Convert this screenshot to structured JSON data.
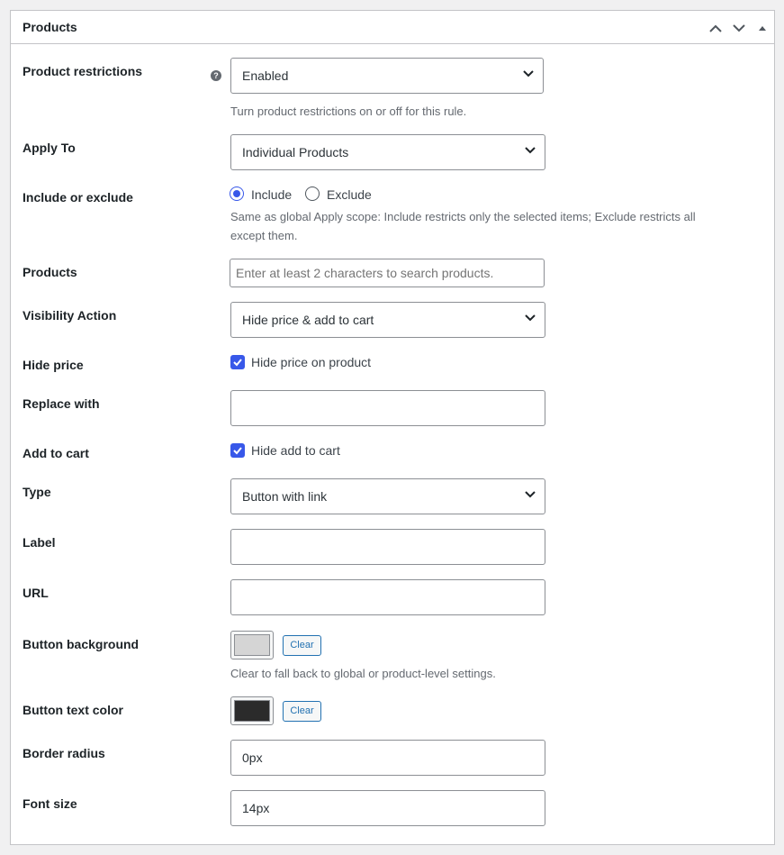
{
  "box": {
    "title": "Products",
    "header_buttons": [
      {
        "icon": "chevron-up-icon"
      },
      {
        "icon": "chevron-down-icon"
      },
      {
        "icon": "triangle-up-icon"
      }
    ]
  },
  "product_restrictions": {
    "label": "Product restrictions",
    "help_icon": "?",
    "value": "Enabled",
    "description": "Turn product restrictions on or off for this rule."
  },
  "apply_to": {
    "label": "Apply To",
    "value": "Individual Products"
  },
  "include_exclude": {
    "label": "Include or exclude",
    "options": [
      {
        "label": "Include",
        "checked": true
      },
      {
        "label": "Exclude",
        "checked": false
      }
    ],
    "description_line1": "Same as global Apply scope: Include restricts only the selected items; Exclude restricts all",
    "description_line2": "except them."
  },
  "products": {
    "label": "Products",
    "placeholder": "Enter at least 2 characters to search products."
  },
  "visibility_action": {
    "label": "Visibility Action",
    "value": "Hide price & add to cart"
  },
  "hide_price": {
    "label": "Hide price",
    "checkbox_label": "Hide price on product",
    "checked": true
  },
  "replace_with": {
    "label": "Replace with",
    "value": ""
  },
  "add_to_cart": {
    "label": "Add to cart",
    "checkbox_label": "Hide add to cart",
    "checked": true
  },
  "type": {
    "label": "Type",
    "value": "Button with link"
  },
  "label_field": {
    "label": "Label",
    "value": ""
  },
  "url_field": {
    "label": "URL",
    "value": ""
  },
  "button_background": {
    "label": "Button background",
    "color": "#d5d5d5",
    "clear_label": "Clear",
    "description": "Clear to fall back to global or product-level settings."
  },
  "button_text_color": {
    "label": "Button text color",
    "color": "#2b2b2b",
    "clear_label": "Clear"
  },
  "border_radius": {
    "label": "Border radius",
    "value": "0px"
  },
  "font_size": {
    "label": "Font size",
    "value": "14px"
  },
  "colors": {
    "accent": "#3858e9",
    "link": "#2271b1",
    "border": "#c3c4c7"
  }
}
